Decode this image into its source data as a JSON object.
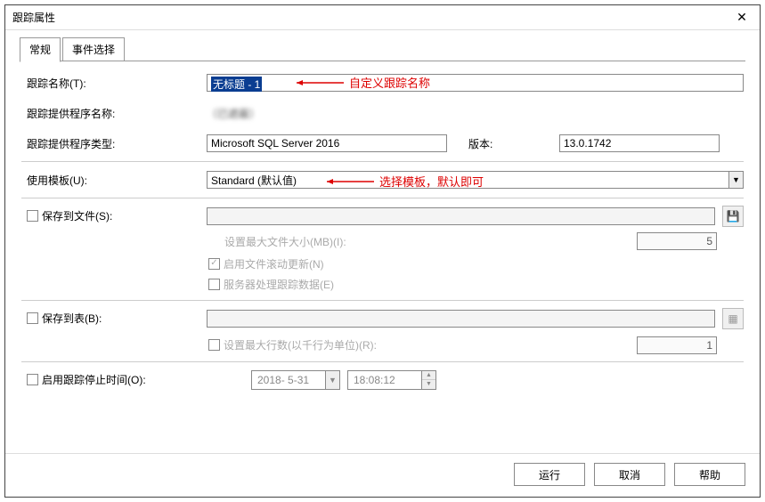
{
  "window": {
    "title": "跟踪属性"
  },
  "tabs": [
    {
      "label": "常规",
      "active": true
    },
    {
      "label": "事件选择",
      "active": false
    }
  ],
  "labels": {
    "trace_name": "跟踪名称(T):",
    "provider_name": "跟踪提供程序名称:",
    "provider_type": "跟踪提供程序类型:",
    "version": "版本:",
    "use_template": "使用模板(U):",
    "save_to_file": "保存到文件(S):",
    "max_file_size": "设置最大文件大小(MB)(I):",
    "enable_rollover": "启用文件滚动更新(N)",
    "server_process": "服务器处理跟踪数据(E)",
    "save_to_table": "保存到表(B):",
    "max_rows": "设置最大行数(以千行为单位)(R):",
    "enable_stop_time": "启用跟踪停止时间(O):"
  },
  "values": {
    "trace_name": "无标题 - 1",
    "provider_name": "（已遮蔽）",
    "provider_type": "Microsoft SQL Server 2016",
    "version": "13.0.1742",
    "template": "Standard (默认值)",
    "max_file_size": "5",
    "max_rows": "1",
    "stop_date": "2018- 5-31",
    "stop_time": "18:08:12",
    "rollover_checked": true
  },
  "annotations": {
    "trace_name": "自定义跟踪名称",
    "template": "选择模板，默认即可"
  },
  "buttons": {
    "run": "运行",
    "cancel": "取消",
    "help": "帮助"
  }
}
